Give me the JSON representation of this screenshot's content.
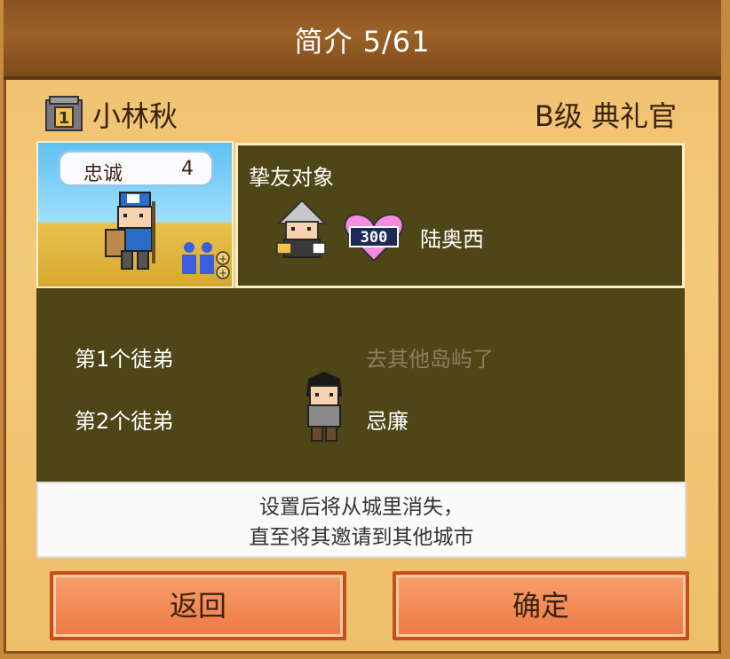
{
  "header": {
    "title": "简介 5/61"
  },
  "character": {
    "name": "小林秋",
    "rank_title": "B级 典礼官",
    "loyalty_label": "忠诚",
    "loyalty_value": "4"
  },
  "friend": {
    "label": "挚友对象",
    "heart_value": "300",
    "name": "陆奥西"
  },
  "disciples": [
    {
      "label": "第1个徒弟",
      "status": "去其他岛屿了"
    },
    {
      "label": "第2个徒弟",
      "name": "忌廉"
    }
  ],
  "note": {
    "line1": "设置后将从城里消失，",
    "line2": "直至将其邀请到其他城市"
  },
  "buttons": {
    "back": "返回",
    "confirm": "确定"
  },
  "colors": {
    "title_bar": "#8a5421",
    "panel": "#f0c070",
    "dark_box": "#4f4617",
    "button": "#f38a55"
  }
}
